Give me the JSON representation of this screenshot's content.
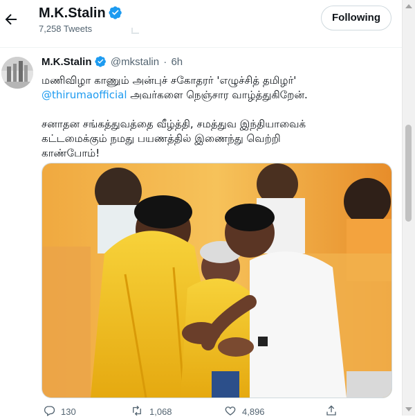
{
  "header": {
    "title": "M.K.Stalin",
    "tweet_count": "7,258 Tweets",
    "follow_button": "Following",
    "back_icon": "arrow-left-icon",
    "verified_icon": "verified-badge-icon"
  },
  "tweet": {
    "author_name": "M.K.Stalin",
    "handle": "@mkstalin",
    "separator": "·",
    "time": "6h",
    "text_line1": "மணிவிழா காணும் அன்புச் சகோதரர் 'எழுச்சித் தமிழர்'",
    "mention": "@thirumaofficial",
    "text_line2_rest": " அவர்களை நெஞ்சார வாழ்த்துகிறேன்.",
    "text_line3": "சனாதன சங்கத்துவத்தை வீழ்த்தி, சமத்துவ இந்தியாவைக்",
    "text_line4": "கட்டமைக்கும் நமது பயணத்தில் இணைந்து வெற்றி",
    "text_line5": "காண்போம்!",
    "replies": "130",
    "retweets": "1,068",
    "likes": "4,896"
  },
  "colors": {
    "accent": "#1d9bf0",
    "text": "#0f1419",
    "secondary": "#536471",
    "photo_yellow": "#f2c41a",
    "photo_orange": "#e89a2c"
  }
}
